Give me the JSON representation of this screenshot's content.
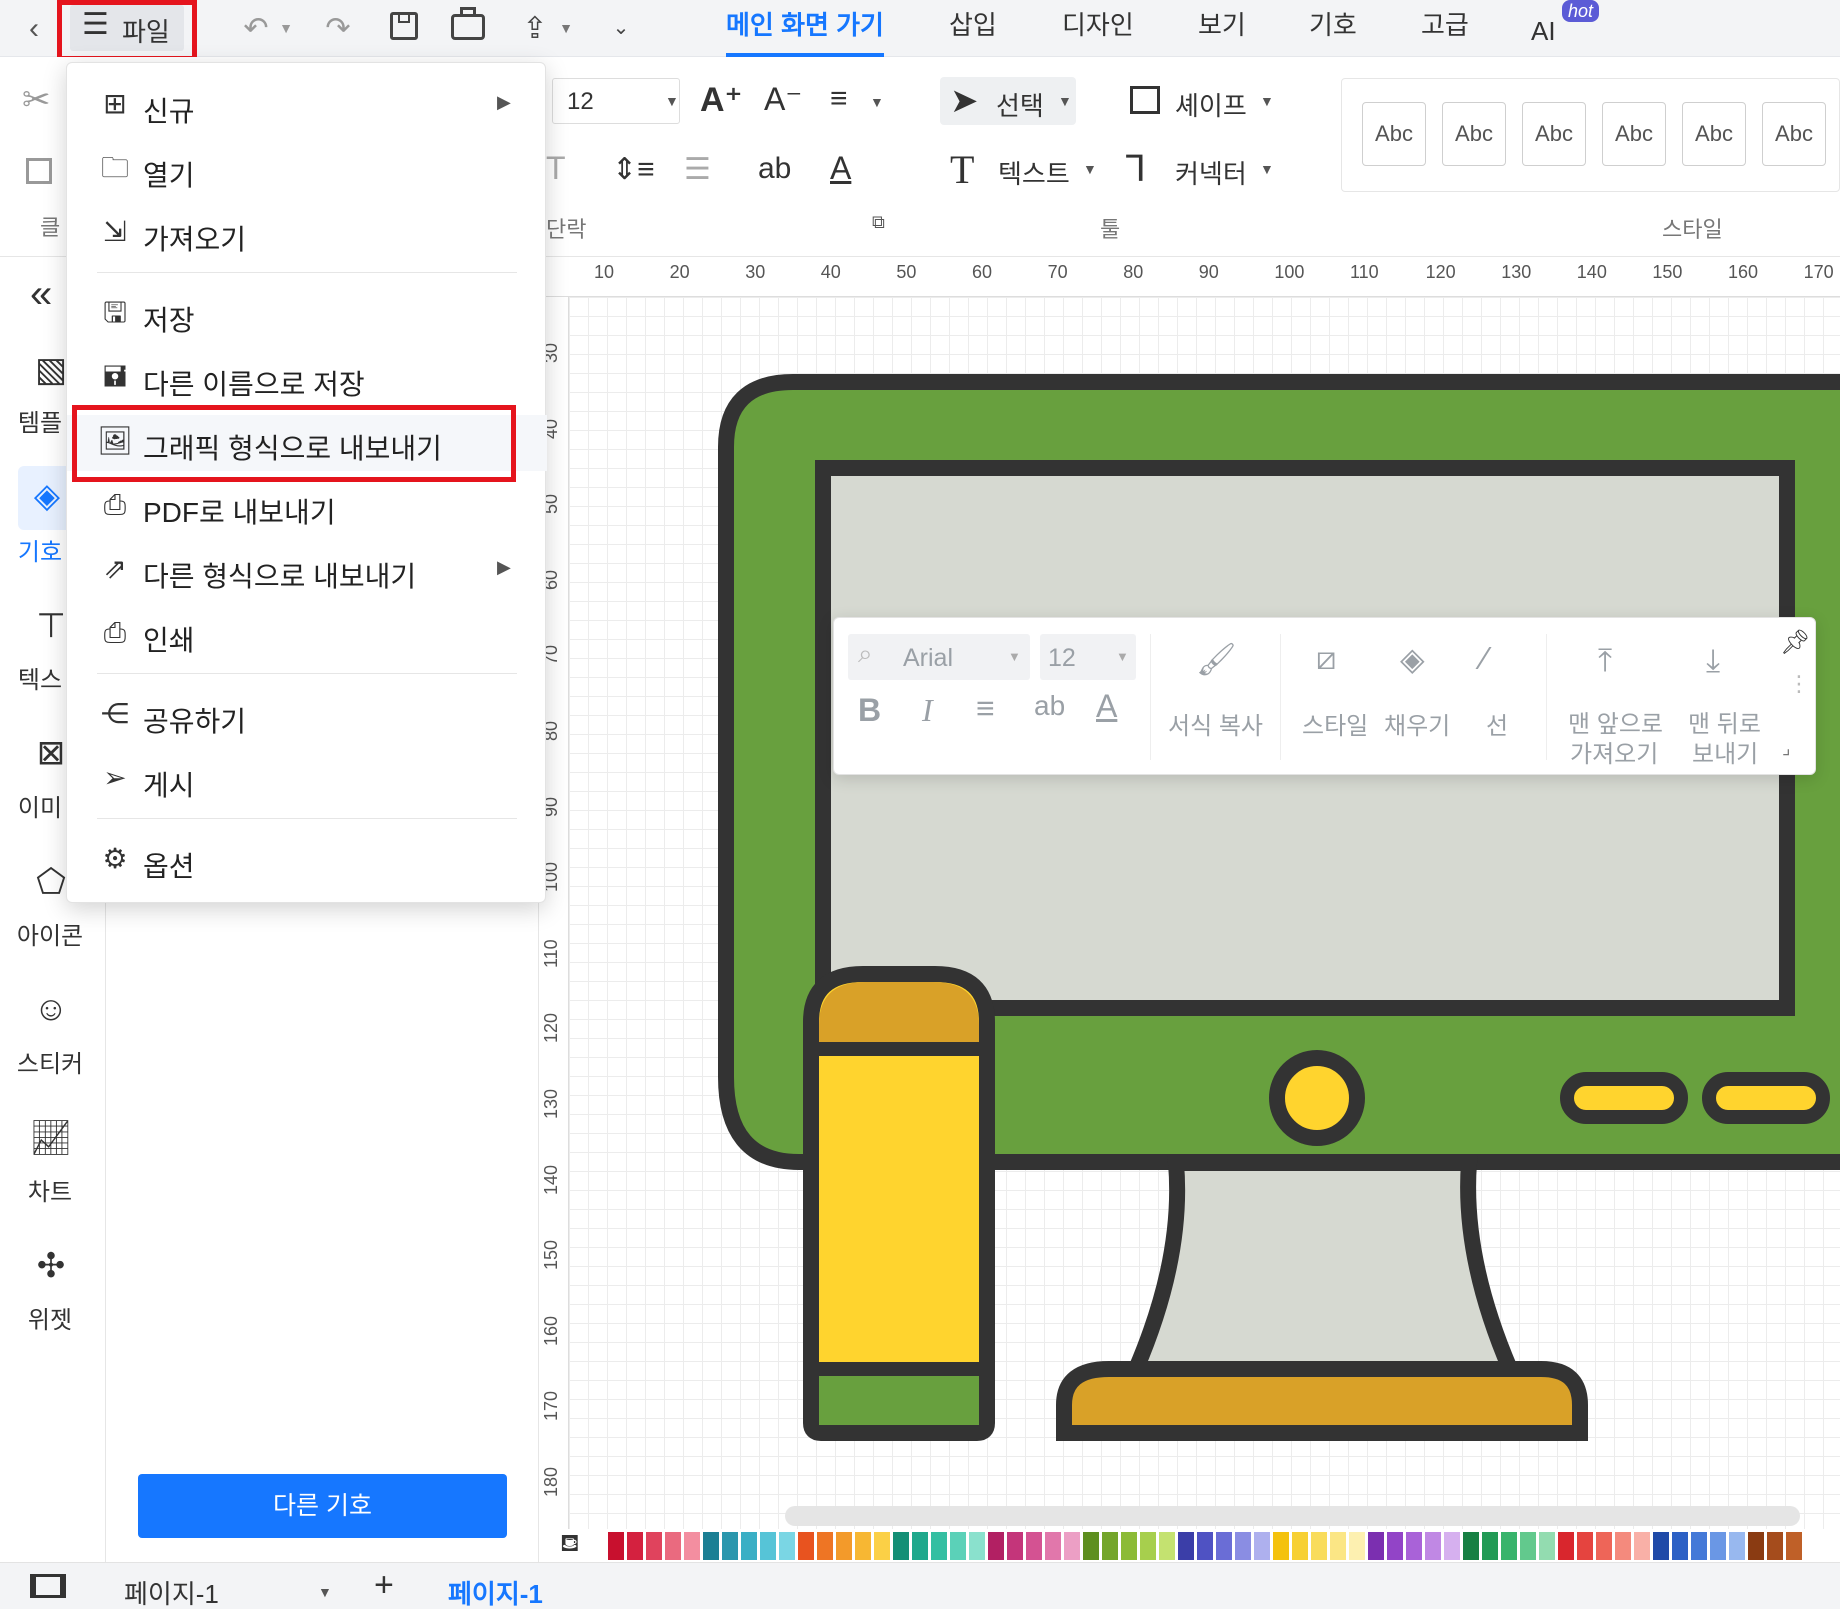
{
  "titlebar": {
    "file_label": "파일",
    "tabs": [
      "메인 화면 가기",
      "삽입",
      "디자인",
      "보기",
      "기호",
      "고급",
      "AI"
    ],
    "hot_badge": "hot"
  },
  "ribbon": {
    "font_size": "12",
    "select_label": "선택",
    "shape_label": "셰이프",
    "text_label": "텍스트",
    "connector_label": "커넥터",
    "abc": [
      "Abc",
      "Abc",
      "Abc",
      "Abc",
      "Abc",
      "Abc"
    ],
    "group_paragraph": "단락",
    "group_tools": "툴",
    "group_style": "스타일",
    "left_group": "클",
    "ab_label": "ab"
  },
  "leftbar": {
    "items": [
      "템플",
      "기호",
      "텍스",
      "이미",
      "아이콘",
      "스티커",
      "차트",
      "위젯"
    ]
  },
  "panel": {
    "more_symbols": "다른 기호"
  },
  "file_menu": {
    "items": [
      "신규",
      "열기",
      "가져오기",
      "저장",
      "다른 이름으로 저장",
      "그래픽 형식으로 내보내기",
      "PDF로 내보내기",
      "다른 형식으로 내보내기",
      "인쇄",
      "공유하기",
      "게시",
      "옵션"
    ]
  },
  "ruler": {
    "top": [
      "10",
      "20",
      "30",
      "40",
      "50",
      "60",
      "70",
      "80",
      "90",
      "100",
      "110",
      "120",
      "130",
      "140",
      "150",
      "160",
      "170"
    ],
    "left": [
      "30",
      "40",
      "50",
      "60",
      "70",
      "80",
      "90",
      "100",
      "110",
      "120",
      "130",
      "140",
      "150",
      "160",
      "170",
      "180"
    ]
  },
  "floating_toolbar": {
    "font": "Arial",
    "size": "12",
    "bold": "B",
    "italic": "I",
    "ab": "ab",
    "format_copy": "서식 복사",
    "style": "스타일",
    "fill": "채우기",
    "line": "선",
    "bring_front_1": "맨 앞으로",
    "bring_front_2": "가져오기",
    "send_back_1": "맨 뒤로",
    "send_back_2": "보내기"
  },
  "bottombar": {
    "page_select": "페이지-1",
    "page_tab": "페이지-1"
  },
  "colors": {
    "accent": "#1677ff",
    "highlight": "#e5141d",
    "monitor_green": "#68a03e",
    "screen_grey": "#d6d9d1",
    "outline": "#333333",
    "yellow": "#ffd42e",
    "gold": "#d9a128"
  }
}
